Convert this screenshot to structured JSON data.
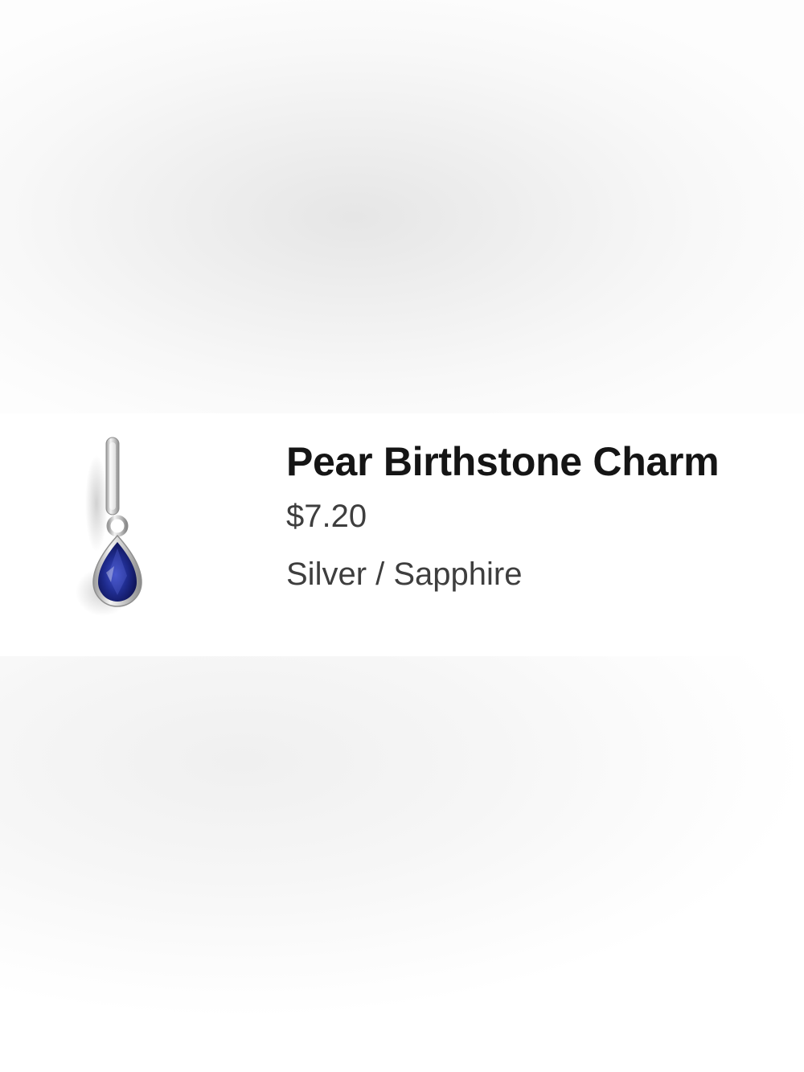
{
  "product": {
    "title": "Pear Birthstone Charm",
    "price": "$7.20",
    "variant": "Silver / Sapphire",
    "image_icon": "pear-sapphire-charm-icon"
  },
  "colors": {
    "gem": "#1f2c8f",
    "metal": "#c8c8c8",
    "title_text": "#151515",
    "secondary_text": "#3e3e3e"
  }
}
